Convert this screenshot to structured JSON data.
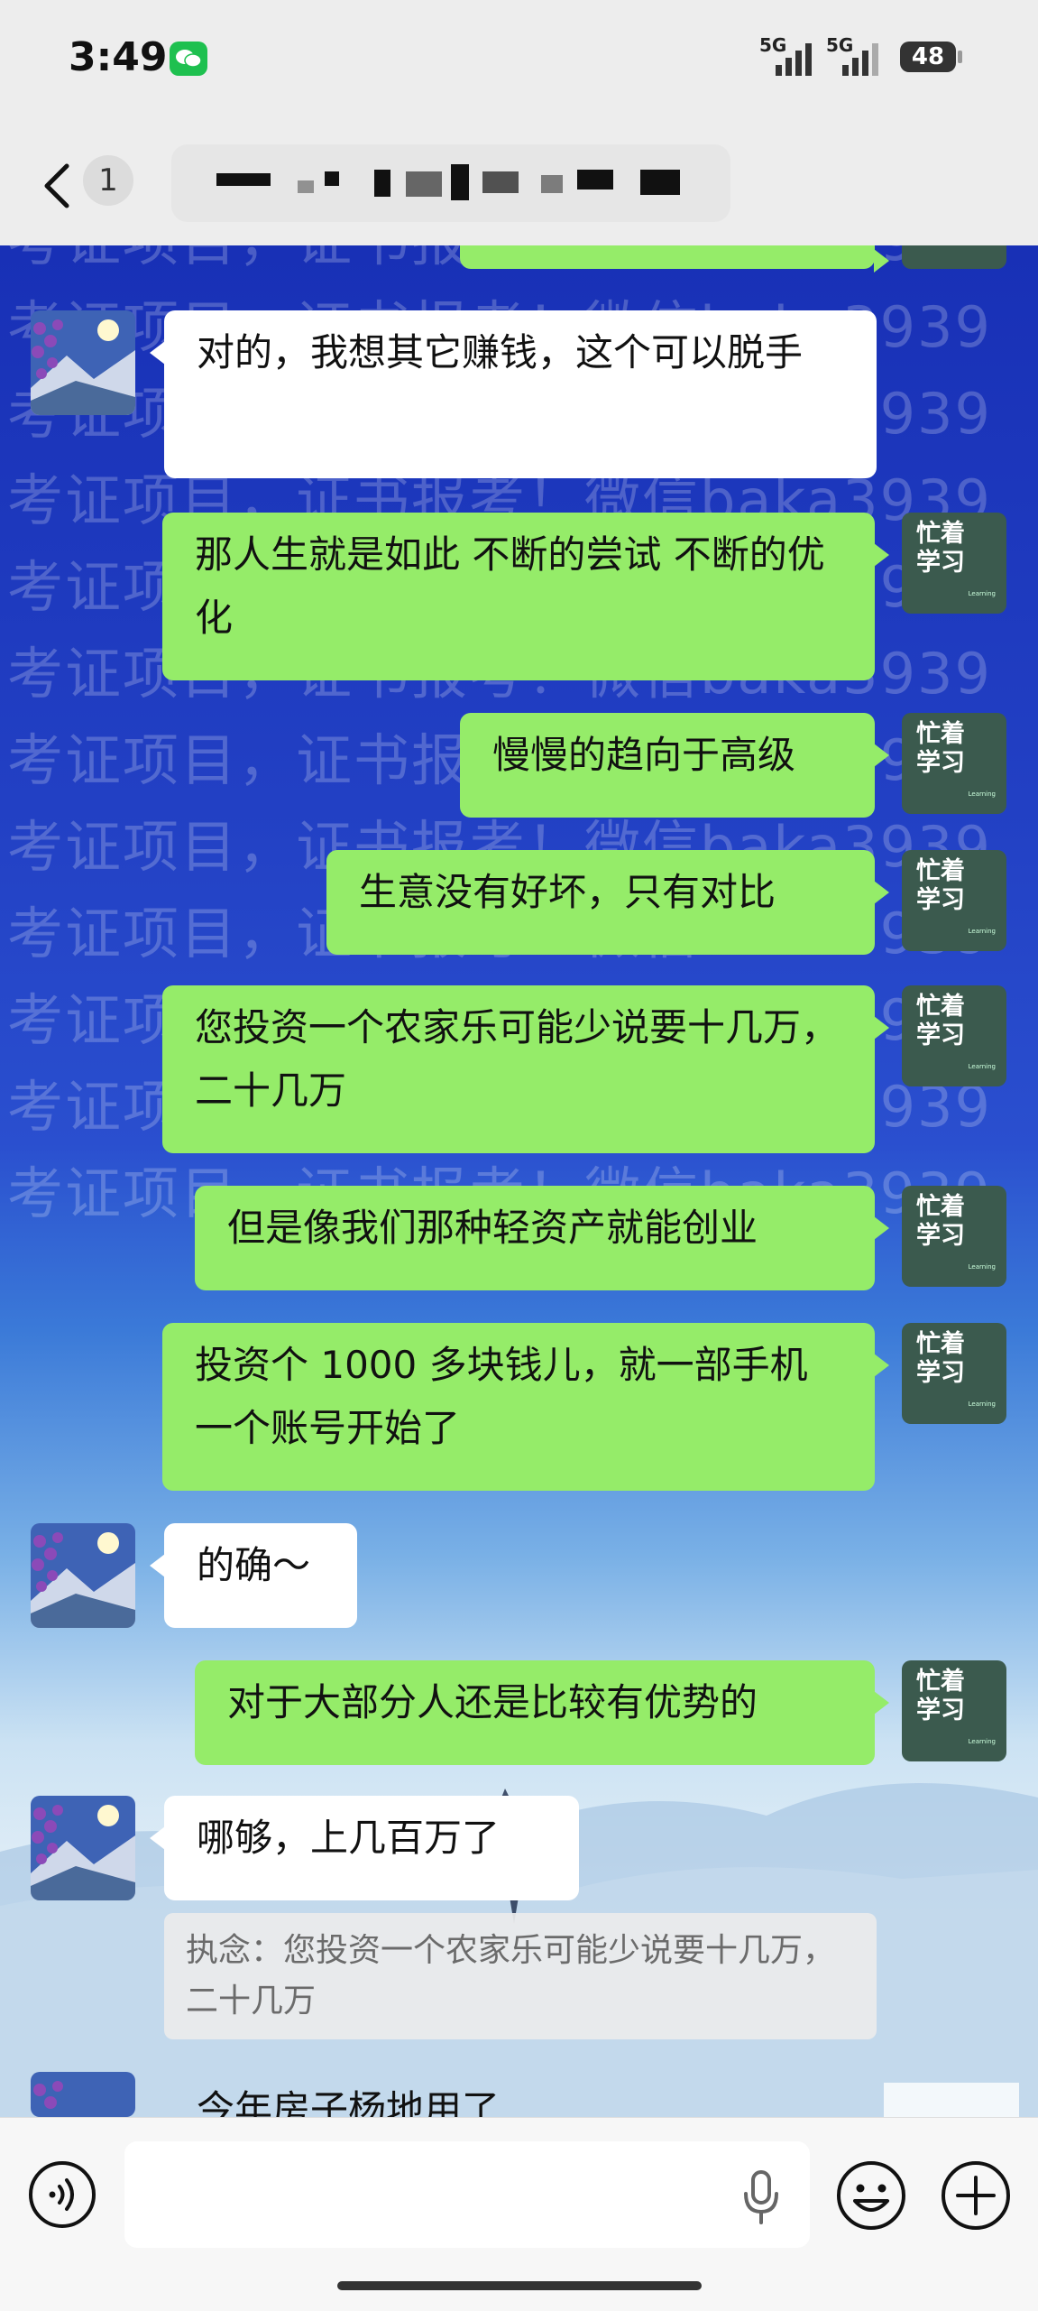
{
  "status_bar": {
    "time": "3:49",
    "net1": "5G",
    "net2": "5G",
    "battery": "48"
  },
  "nav": {
    "unread_count": "1"
  },
  "watermark": {
    "lines": [
      "考证项目，证书报考！微信baka3939",
      "考证项目，证书报考！微信baka3939",
      "考证项目，证书报考！微信baka3939",
      "考证项目，证书报考！微信baka3939",
      "考证项目，证书报考！微信baka3939",
      "考证项目，证书报考！微信baka3939",
      "考证项目，证书报考！微信baka3939",
      "考证项目，证书报考！微信baka3939",
      "考证项目，证书报考！微信baka3939",
      "考证项目，证书报考！微信baka3939",
      "考证项目，证书报考！微信baka3939",
      "考证项目，证书报考！微信baka3939"
    ]
  },
  "self_avatar": {
    "line1": "忙着",
    "line2": "学习",
    "tiny": "Learning"
  },
  "messages": [
    {
      "sender": "other",
      "text": "对的，我想其它赚钱，这个可以脱手"
    },
    {
      "sender": "self",
      "text": "那人生就是如此 不断的尝试 不断的优化"
    },
    {
      "sender": "self",
      "text": "慢慢的趋向于高级"
    },
    {
      "sender": "self",
      "text": "生意没有好坏，只有对比"
    },
    {
      "sender": "self",
      "text": "您投资一个农家乐可能少说要十几万，二十几万"
    },
    {
      "sender": "self",
      "text": "但是像我们那种轻资产就能创业"
    },
    {
      "sender": "self",
      "text": "投资个 1000 多块钱儿，就一部手机一个账号开始了"
    },
    {
      "sender": "other",
      "text": "的确～"
    },
    {
      "sender": "self",
      "text": "对于大部分人还是比较有优势的"
    },
    {
      "sender": "other",
      "text": "哪够，上几百万了"
    }
  ],
  "quote": {
    "text": "执念：您投资一个农家乐可能少说要十几万，二十几万"
  },
  "partial_message": {
    "text": "今年房子杨地用了"
  },
  "colors": {
    "self_bubble": "#95ec69",
    "other_bubble": "#ffffff",
    "bar_bg": "#ededed"
  }
}
